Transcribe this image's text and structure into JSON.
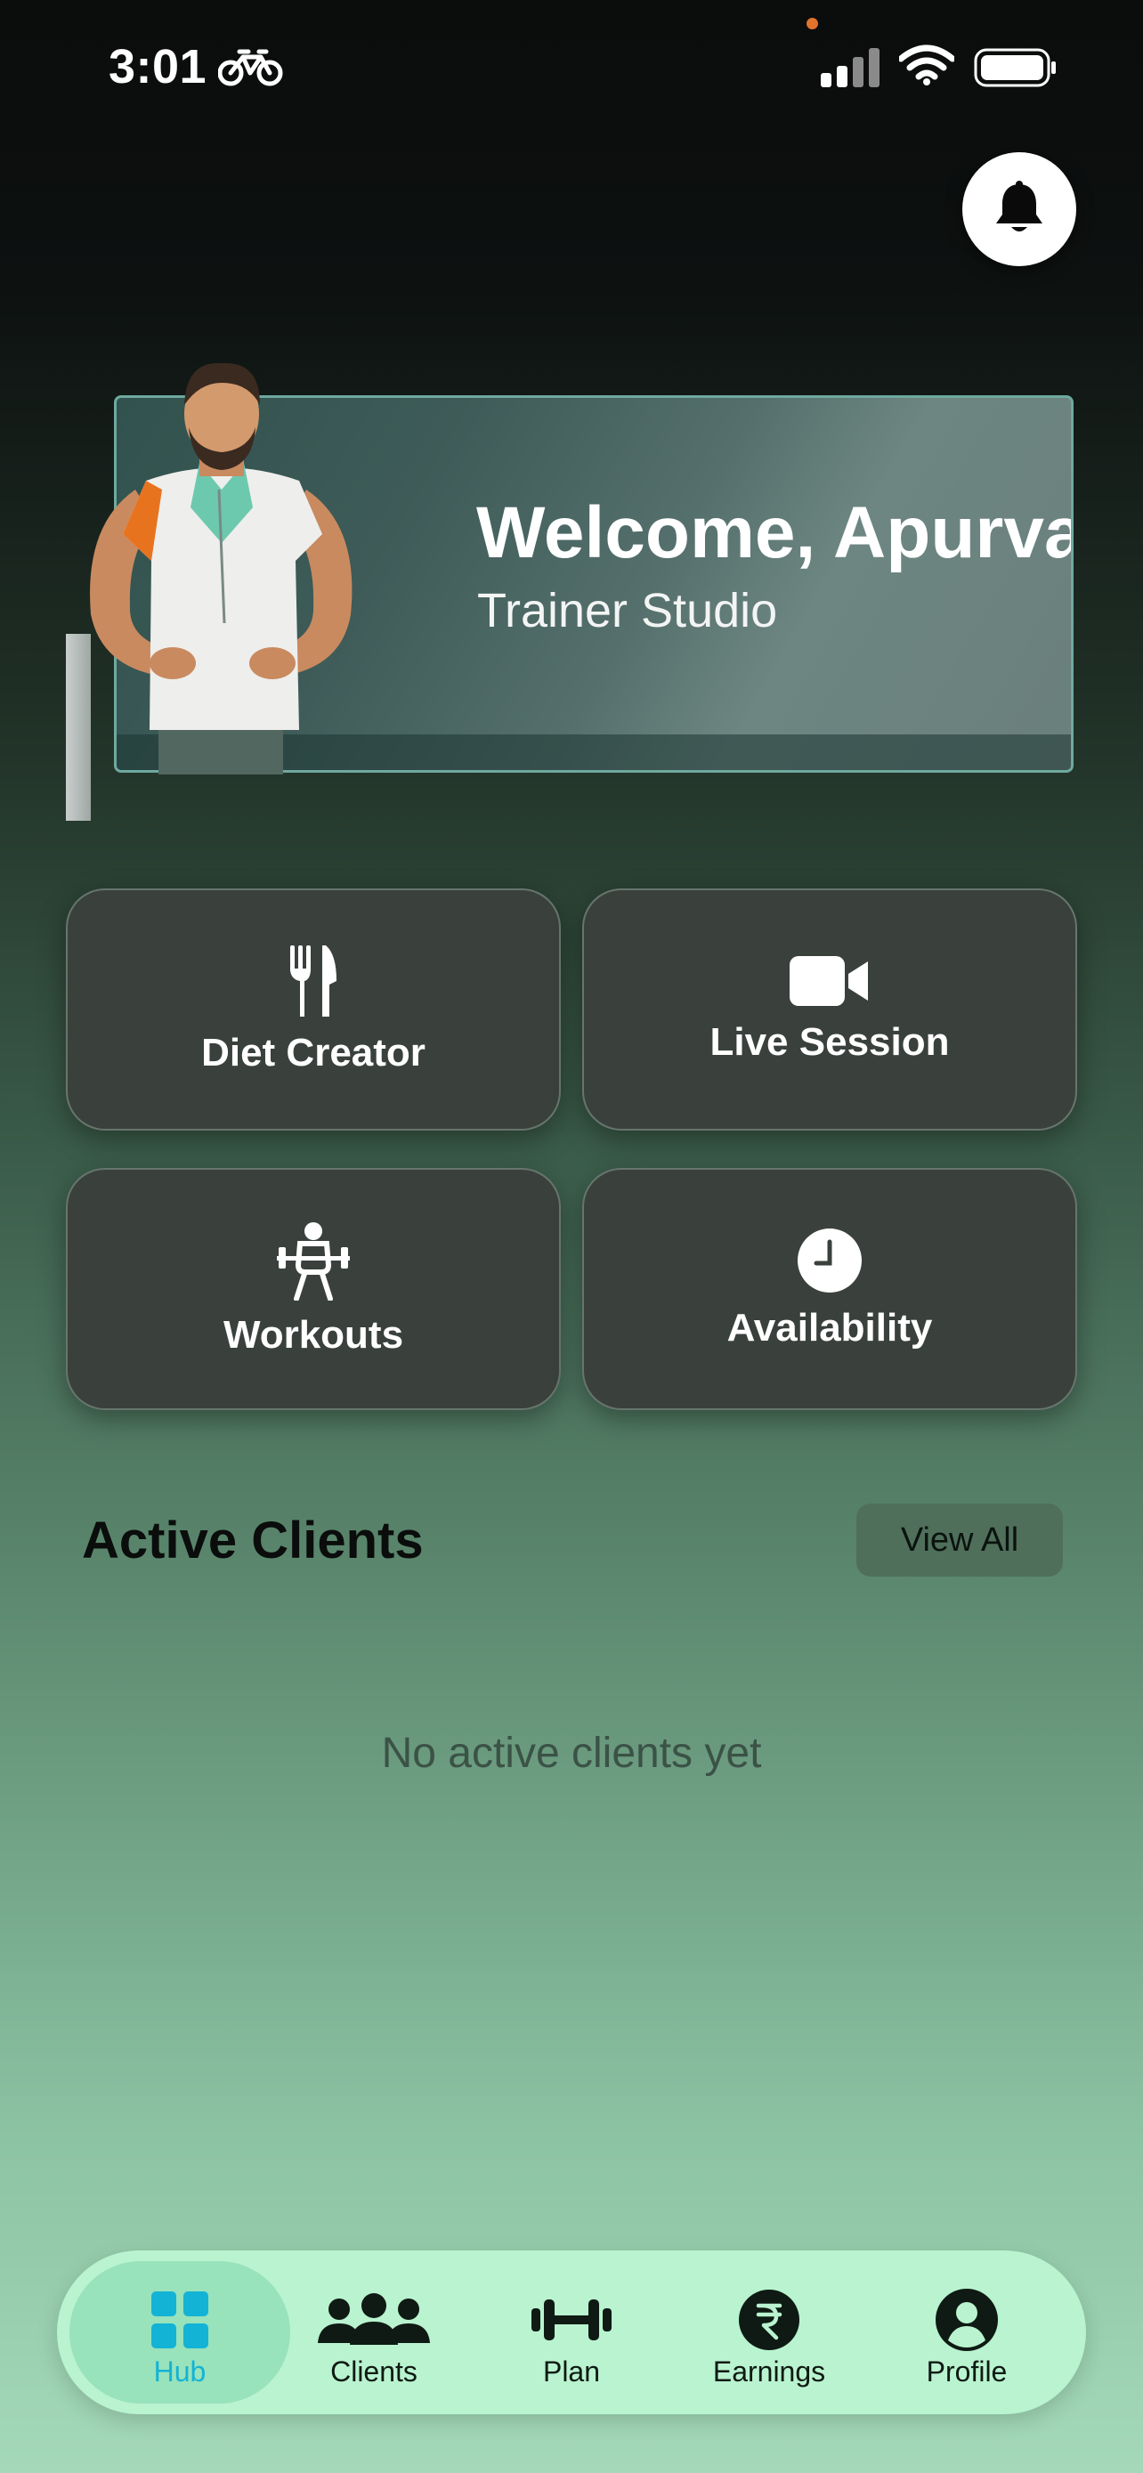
{
  "status_bar": {
    "time": "3:01"
  },
  "header": {
    "notification_icon": "bell-icon"
  },
  "hero": {
    "title": "Welcome, Apurva",
    "subtitle": "Trainer Studio"
  },
  "tiles": [
    {
      "label": "Diet Creator",
      "icon": "fork-knife-icon"
    },
    {
      "label": "Live Session",
      "icon": "video-camera-icon"
    },
    {
      "label": "Workouts",
      "icon": "weightlifter-icon"
    },
    {
      "label": "Availability",
      "icon": "clock-icon"
    }
  ],
  "clients": {
    "title": "Active Clients",
    "view_all": "View All",
    "empty": "No active clients yet"
  },
  "tab_bar": {
    "active": "Hub",
    "tabs": [
      {
        "label": "Hub",
        "icon": "grid-icon"
      },
      {
        "label": "Clients",
        "icon": "people-icon"
      },
      {
        "label": "Plan",
        "icon": "dumbbell-icon"
      },
      {
        "label": "Earnings",
        "icon": "rupee-icon"
      },
      {
        "label": "Profile",
        "icon": "person-icon"
      }
    ]
  },
  "colors": {
    "accent": "#13B3D6",
    "tab_bar": "#B9F3CF",
    "tile": "#3A413D"
  }
}
